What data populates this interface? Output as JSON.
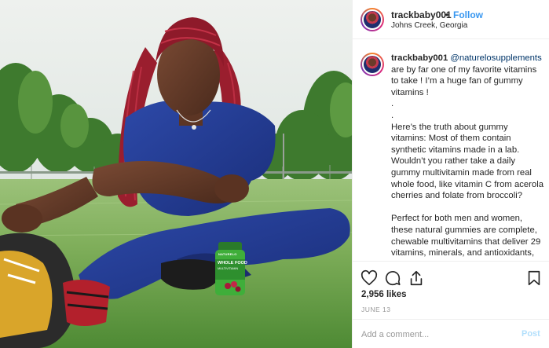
{
  "post": {
    "username": "trackbaby001",
    "separator": "•",
    "follow_label": "Follow",
    "location": "Johns Creek, Georgia"
  },
  "caption": {
    "username": "trackbaby001",
    "mention": "@naturelosupplements",
    "line1": "are by far one of my favorite vitamins to take ! I’m a huge fan of gummy vitamins !",
    "dot1": ".",
    "dot2": ".",
    "para2": "Here’s the truth about gummy vitamins: Most of them contain synthetic vitamins made in a lab. Wouldn’t you rather take a daily gummy multivitamin made from real whole food, like vitamin C from acerola cherries and folate from broccoli?",
    "para3": "Perfect for both men and women, these natural gummies are complete, chewable multivitamins that deliver 29 vitamins, minerals, and antioxidants, plus the cofactors that naturally occur with them, making them"
  },
  "photo": {
    "bottle_brand": "NATURELO",
    "bottle_line1": "WHOLE FOOD",
    "bottle_line2": "MULTIVITAMIN"
  },
  "actions": {
    "like_icon": "heart-icon",
    "comment_icon": "comment-bubble-icon",
    "share_icon": "share-icon",
    "save_icon": "bookmark-icon"
  },
  "likes_text": "2,956 likes",
  "date_text": "JUNE 13",
  "comment_box": {
    "placeholder": "Add a comment...",
    "post_label": "Post"
  },
  "colors": {
    "link_blue": "#3897f0",
    "mention_blue": "#003569",
    "post_disabled": "#b2dffc",
    "muted_text": "#999999"
  }
}
